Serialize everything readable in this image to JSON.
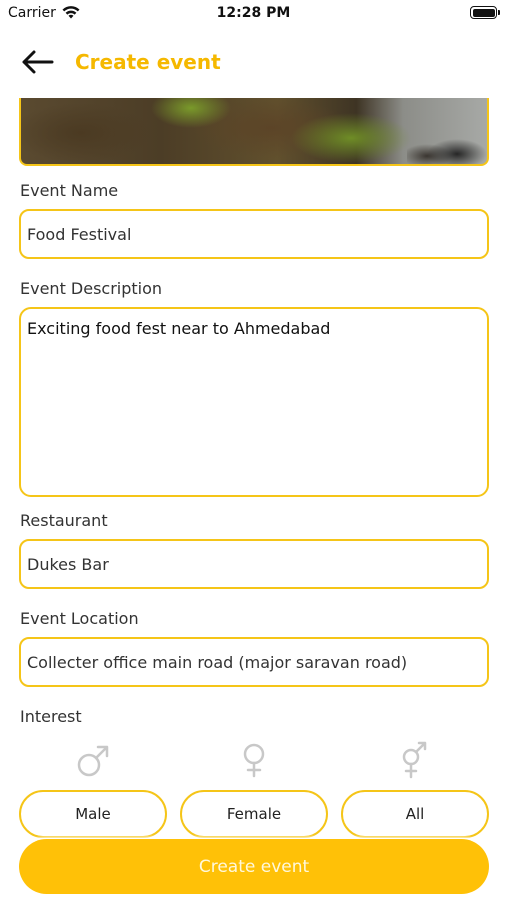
{
  "status_bar": {
    "carrier": "Carrier",
    "time": "12:28 PM"
  },
  "header": {
    "title": "Create event",
    "back_icon": "arrow-left-icon"
  },
  "form": {
    "event_name": {
      "label": "Event Name",
      "value": "Food Festival"
    },
    "event_description": {
      "label": "Event Description",
      "value": "Exciting food fest near to Ahmedabad"
    },
    "restaurant": {
      "label": "Restaurant",
      "value": "Dukes Bar"
    },
    "event_location": {
      "label": "Event Location",
      "value": "Collecter office main road (major saravan road)"
    },
    "interest": {
      "label": "Interest",
      "options": [
        {
          "label": "Male",
          "icon": "male-symbol-icon"
        },
        {
          "label": "Female",
          "icon": "female-symbol-icon"
        },
        {
          "label": "All",
          "icon": "transgender-symbol-icon"
        }
      ]
    }
  },
  "actions": {
    "create_label": "Create event"
  },
  "colors": {
    "accent": "#ffc107",
    "border": "#f5c518",
    "title": "#f5b800"
  }
}
